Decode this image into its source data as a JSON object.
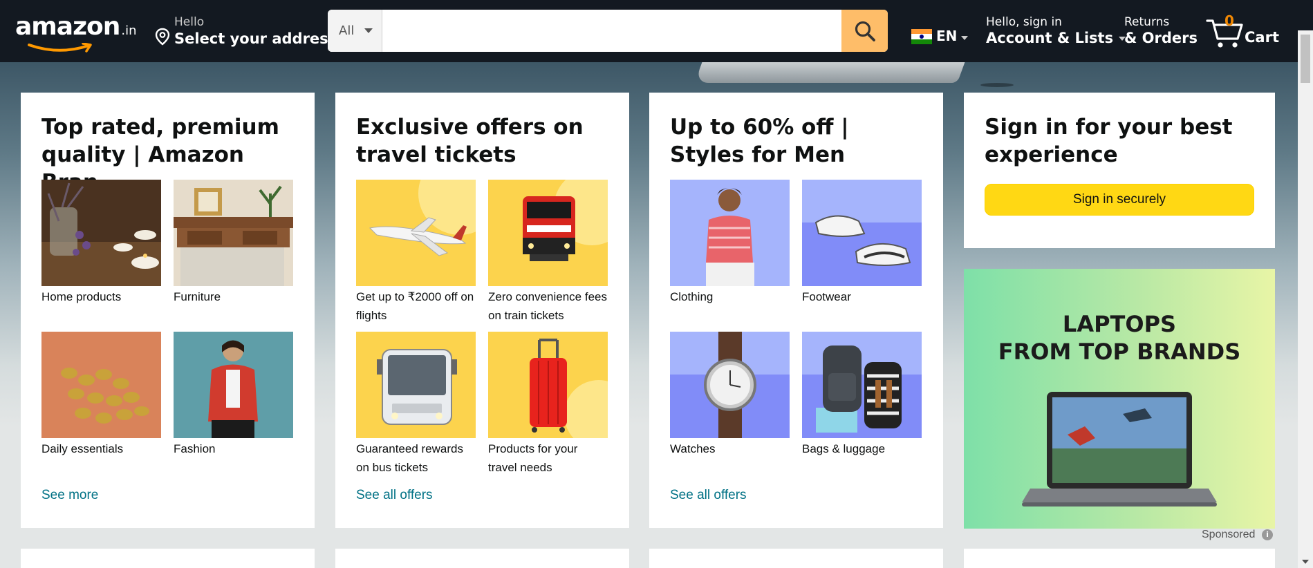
{
  "header": {
    "logo_text": "amazon",
    "logo_suffix": ".in",
    "address_hello": "Hello",
    "address_select": "Select your address",
    "search_category": "All",
    "search_placeholder": "",
    "language": "EN",
    "account_line1": "Hello, sign in",
    "account_line2": "Account & Lists",
    "orders_line1": "Returns",
    "orders_line2": "& Orders",
    "cart_count": "0",
    "cart_label": "Cart"
  },
  "cards": [
    {
      "title": "Top rated, premium quality | Amazon Bran…",
      "tiles": [
        {
          "caption": "Home products",
          "icon": "home-products-image"
        },
        {
          "caption": "Furniture",
          "icon": "furniture-image"
        },
        {
          "caption": "Daily essentials",
          "icon": "daily-essentials-image"
        },
        {
          "caption": "Fashion",
          "icon": "fashion-image"
        }
      ],
      "link": "See more"
    },
    {
      "title": "Exclusive offers on travel tickets",
      "tiles": [
        {
          "caption": "Get up to ₹2000 off on flights",
          "icon": "airplane-image"
        },
        {
          "caption": "Zero convenience fees on train tickets",
          "icon": "train-image"
        },
        {
          "caption": "Guaranteed rewards on bus tickets",
          "icon": "bus-image"
        },
        {
          "caption": "Products for your travel needs",
          "icon": "suitcase-image"
        }
      ],
      "link": "See all offers"
    },
    {
      "title": "Up to 60% off | Styles for Men",
      "tiles": [
        {
          "caption": "Clothing",
          "icon": "clothing-image"
        },
        {
          "caption": "Footwear",
          "icon": "footwear-image"
        },
        {
          "caption": "Watches",
          "icon": "watch-image"
        },
        {
          "caption": "Bags & luggage",
          "icon": "bags-image"
        }
      ],
      "link": "See all offers"
    },
    {
      "title": "Sign in for your best experience",
      "button": "Sign in securely"
    }
  ],
  "ad": {
    "headline_line1": "LAPTOPS",
    "headline_line2": "FROM TOP BRANDS",
    "sponsored": "Sponsored"
  },
  "colors": {
    "header_bg": "#131921",
    "search_button": "#febd69",
    "signin_button": "#ffd814",
    "link": "#007185",
    "cart_count": "#f08804"
  }
}
